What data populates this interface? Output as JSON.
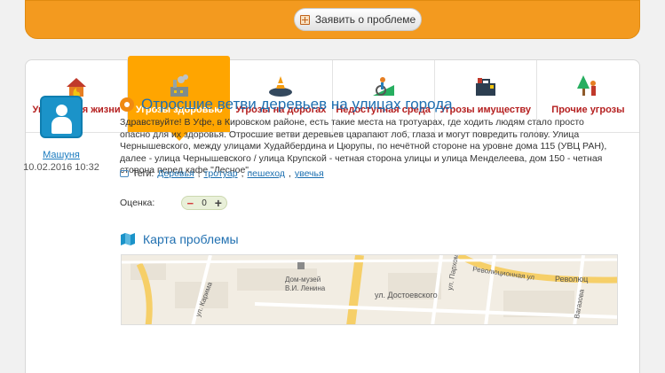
{
  "header": {
    "report_button": "Заявить о проблеме"
  },
  "tabs": [
    {
      "label": "Угрозы для жизни",
      "icon": "fire-house-icon"
    },
    {
      "label": "Угрозы здоровью",
      "icon": "factory-smoke-icon",
      "active": true
    },
    {
      "label": "Угрозы на дорогах",
      "icon": "road-barrier-icon"
    },
    {
      "label": "Недоступная среда",
      "icon": "wheelchair-icon"
    },
    {
      "label": "Угрозы имуществу",
      "icon": "briefcase-icon"
    },
    {
      "label": "Прочие угрозы",
      "icon": "tree-person-icon"
    }
  ],
  "post": {
    "author": "Машуня",
    "date": "10.02.2016 10:32",
    "title": "Отросшие ветви деревьев на улицах города",
    "text": "Здравствуйте! В Уфе, в Кировском районе, есть такие места на тротуарах, где ходить людям стало просто опасно для их здоровья. Отросшие ветви деревьев царапают лоб, глаза и могут повредить голову. Улица Чернышевского, между улицами Худайбердина и Цюрупы, по нечётной стороне на уровне дома 115 (УВЦ РАН), далее - улица Чернышевского / улица Крупской - четная сторона улицы  и  улица Менделеева, дом 150 - четная сторона перед кафе \"Лесное\".",
    "tags_label": "Теги:",
    "tags": [
      "Деревья",
      "тротуар",
      "пешеход",
      "увечья"
    ],
    "rating_label": "Оценка:",
    "rating_value": "0"
  },
  "map": {
    "title": "Карта проблемы",
    "labels": {
      "museum": "Дом-музей",
      "museum2": "В.И. Ленина",
      "dostoevsky": "ул. Достоевского",
      "revolution": "Революционная ул",
      "revolution2": "Революц",
      "karim": "ул. Карима",
      "parkhom": "ул. Пархом",
      "vagazova": "Вагазова"
    }
  },
  "colors": {
    "accent": "#f39a1f",
    "active_tab": "#ffa500",
    "link": "#1b7bbf",
    "tab_text": "#b52020"
  }
}
